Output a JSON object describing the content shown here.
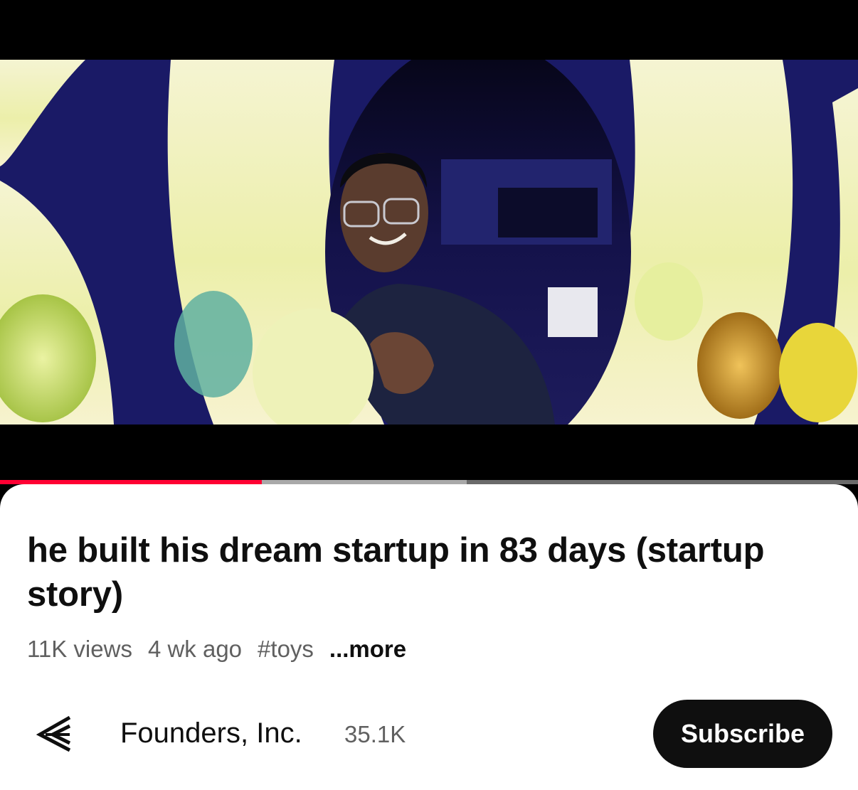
{
  "player": {
    "progress_played": 0.305,
    "progress_buffered": 0.544,
    "colors": {
      "played": "#ff0033",
      "buffered": "#a9a9a9",
      "track": "#6b6b6b"
    }
  },
  "video": {
    "title": "he built his dream startup in 83 days (startup story)",
    "views": "11K views",
    "age": "4 wk ago",
    "hashtag": "#toys",
    "more_label": "...more"
  },
  "channel": {
    "avatar_icon": "founders-inc-logo-icon",
    "name": "Founders, Inc.",
    "subscriber_count": "35.1K",
    "subscribe_label": "Subscribe"
  }
}
